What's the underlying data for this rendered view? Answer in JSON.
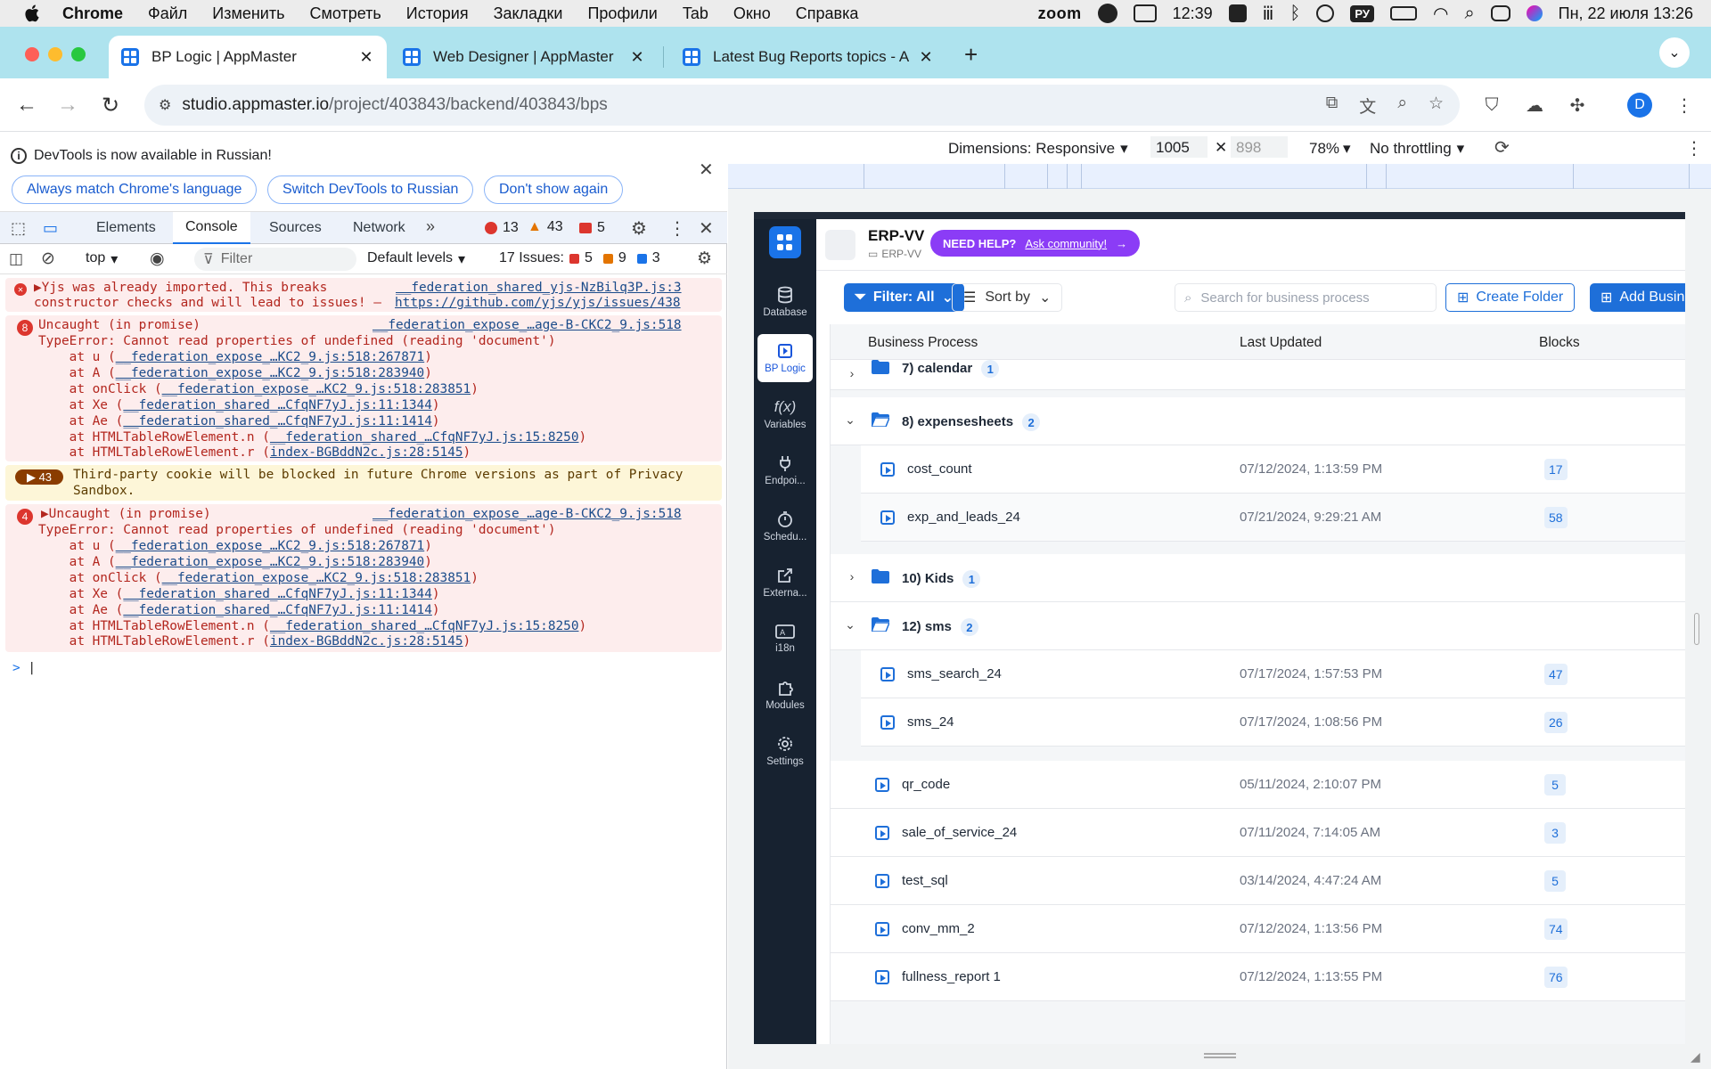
{
  "menubar": {
    "app": "Chrome",
    "items": [
      "Файл",
      "Изменить",
      "Смотреть",
      "История",
      "Закладки",
      "Профили",
      "Tab",
      "Окно",
      "Справка"
    ],
    "zoom": "zoom",
    "time_a": "12:39",
    "lang": "РУ",
    "datetime": "Пн, 22 июля  13:26"
  },
  "tabs": [
    {
      "title": "BP Logic | AppMaster"
    },
    {
      "title": "Web Designer | AppMaster"
    },
    {
      "title": "Latest Bug Reports topics - A"
    }
  ],
  "address": {
    "host": "studio.appmaster.io",
    "path": "/project/403843/backend/403843/bps"
  },
  "profile_initial": "D",
  "devtools": {
    "infobar": {
      "message": "DevTools is now available in Russian!",
      "btn_match": "Always match Chrome's language",
      "btn_switch": "Switch DevTools to Russian",
      "btn_dont": "Don't show again"
    },
    "tabs": [
      "Elements",
      "Console",
      "Sources",
      "Network"
    ],
    "counts": {
      "errors": "13",
      "warnings": "43",
      "issues_badge": "5"
    },
    "console_toolbar": {
      "context": "top",
      "filter_placeholder": "Filter",
      "levels": "Default levels",
      "issues_label": "17 Issues:",
      "issues_err": "5",
      "issues_warn": "9",
      "issues_info": "3"
    },
    "log": [
      {
        "type": "error",
        "badge": "",
        "lines": [
          {
            "text": "▶Yjs was already imported. This breaks",
            "link": "__federation_shared_yjs-NzBilq3P.js:3"
          },
          {
            "text": "constructor checks and will lead to issues! – ",
            "link": "https://github.com/yjs/yjs/issues/438"
          }
        ]
      },
      {
        "type": "error",
        "badge": "8",
        "lines": [
          {
            "text": "Uncaught (in promise)",
            "link": "__federation_expose_…age-B-CKC2_9.js:518"
          },
          {
            "text": "TypeError: Cannot read properties of undefined (reading 'document')"
          },
          {
            "text": "    at u (",
            "link": "__federation_expose_…KC2_9.js:518:267871",
            "tail": ")"
          },
          {
            "text": "    at A (",
            "link": "__federation_expose_…KC2_9.js:518:283940",
            "tail": ")"
          },
          {
            "text": "    at onClick (",
            "link": "__federation_expose_…KC2_9.js:518:283851",
            "tail": ")"
          },
          {
            "text": "    at Xe (",
            "link": "__federation_shared_…CfqNF7yJ.js:11:1344",
            "tail": ")"
          },
          {
            "text": "    at Ae (",
            "link": "__federation_shared_…CfqNF7yJ.js:11:1414",
            "tail": ")"
          },
          {
            "text": "    at HTMLTableRowElement.n (",
            "link": "__federation_shared_…CfqNF7yJ.js:15:8250",
            "tail": ")"
          },
          {
            "text": "    at HTMLTableRowElement.r (",
            "link": "index-BGBddN2c.js:28:5145",
            "tail": ")"
          }
        ]
      },
      {
        "type": "warning",
        "badge": "43",
        "lines": [
          {
            "text": "Third-party cookie will be blocked in future Chrome versions as part of Privacy"
          },
          {
            "text": "Sandbox."
          }
        ]
      },
      {
        "type": "error",
        "badge": "4",
        "lines": [
          {
            "text": "▶Uncaught (in promise)",
            "link": "__federation_expose_…age-B-CKC2_9.js:518"
          },
          {
            "text": "TypeError: Cannot read properties of undefined (reading 'document')"
          },
          {
            "text": "    at u (",
            "link": "__federation_expose_…KC2_9.js:518:267871",
            "tail": ")"
          },
          {
            "text": "    at A (",
            "link": "__federation_expose_…KC2_9.js:518:283940",
            "tail": ")"
          },
          {
            "text": "    at onClick (",
            "link": "__federation_expose_…KC2_9.js:518:283851",
            "tail": ")"
          },
          {
            "text": "    at Xe (",
            "link": "__federation_shared_…CfqNF7yJ.js:11:1344",
            "tail": ")"
          },
          {
            "text": "    at Ae (",
            "link": "__federation_shared_…CfqNF7yJ.js:11:1414",
            "tail": ")"
          },
          {
            "text": "    at HTMLTableRowElement.n (",
            "link": "__federation_shared_…CfqNF7yJ.js:15:8250",
            "tail": ")"
          },
          {
            "text": "    at HTMLTableRowElement.r (",
            "link": "index-BGBddN2c.js:28:5145",
            "tail": ")"
          }
        ]
      }
    ],
    "prompt": ">"
  },
  "device": {
    "dimensions": "Dimensions: Responsive",
    "width": "1005",
    "height": "898",
    "zoom": "78%",
    "throttling": "No throttling"
  },
  "app": {
    "sidebar": [
      {
        "label": "Database",
        "icon": "database-icon"
      },
      {
        "label": "BP Logic",
        "icon": "bp-logic-icon"
      },
      {
        "label": "Variables",
        "icon": "function-icon"
      },
      {
        "label": "Endpoi...",
        "icon": "plug-icon"
      },
      {
        "label": "Schedu...",
        "icon": "timer-icon"
      },
      {
        "label": "Externa...",
        "icon": "external-link-icon"
      },
      {
        "label": "i18n",
        "icon": "translate-icon"
      },
      {
        "label": "Modules",
        "icon": "puzzle-icon"
      },
      {
        "label": "Settings",
        "icon": "gear-icon"
      }
    ],
    "project_name": "ERP-VV",
    "project_path": "ERP-VV",
    "help_label": "NEED HELP?",
    "help_link": "Ask community!",
    "filter_label": "Filter: All",
    "sort_label": "Sort by",
    "search_placeholder": "Search for business process",
    "create_folder": "Create Folder",
    "add_business": "Add Business",
    "columns": [
      "Business Process",
      "Last Updated",
      "Blocks"
    ],
    "rows": [
      {
        "kind": "folder",
        "open": false,
        "name": "7) calendar",
        "count": "1"
      },
      {
        "kind": "folder",
        "open": true,
        "name": "8) expensesheets",
        "count": "2"
      },
      {
        "kind": "child",
        "name": "cost_count",
        "date": "07/12/2024, 1:13:59 PM",
        "blocks": "17"
      },
      {
        "kind": "child",
        "name": "exp_and_leads_24",
        "date": "07/21/2024, 9:29:21 AM",
        "blocks": "58"
      },
      {
        "kind": "folder",
        "open": false,
        "name": "10) Kids",
        "count": "1"
      },
      {
        "kind": "folder",
        "open": true,
        "name": "12) sms",
        "count": "2"
      },
      {
        "kind": "child",
        "name": "sms_search_24",
        "date": "07/17/2024, 1:57:53 PM",
        "blocks": "47"
      },
      {
        "kind": "child",
        "name": "sms_24",
        "date": "07/17/2024, 1:08:56 PM",
        "blocks": "26"
      },
      {
        "kind": "item",
        "name": "qr_code",
        "date": "05/11/2024, 2:10:07 PM",
        "blocks": "5"
      },
      {
        "kind": "item",
        "name": "sale_of_service_24",
        "date": "07/11/2024, 7:14:05 AM",
        "blocks": "3"
      },
      {
        "kind": "item",
        "name": "test_sql",
        "date": "03/14/2024, 4:47:24 AM",
        "blocks": "5"
      },
      {
        "kind": "item",
        "name": "conv_mm_2",
        "date": "07/12/2024, 1:13:56 PM",
        "blocks": "74"
      },
      {
        "kind": "item",
        "name": "fullness_report 1",
        "date": "07/12/2024, 1:13:55 PM",
        "blocks": "76"
      }
    ]
  }
}
